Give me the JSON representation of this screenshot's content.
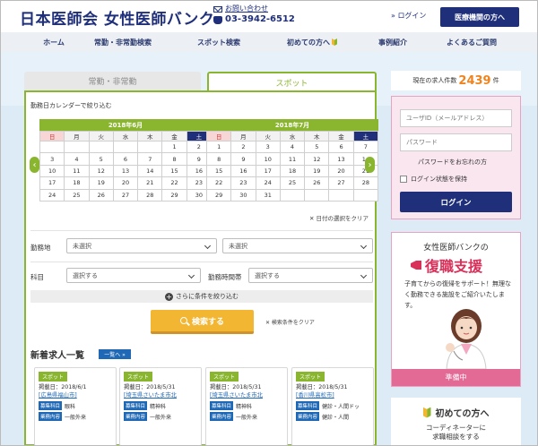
{
  "header": {
    "logo": "日本医師会 女性医師バンク",
    "contact_label": "お問い合わせ",
    "phone": "03-3942-6512",
    "login_link": "» ログイン",
    "institution_button": "医療機関の方へ"
  },
  "nav": {
    "items": [
      "ホーム",
      "常勤・非常勤検索",
      "スポット検索",
      "初めての方へ",
      "事例紹介",
      "よくあるご質問"
    ]
  },
  "search": {
    "tab_fulltime": "常勤・非常勤",
    "tab_spot": "スポット",
    "calendar_title": "勤務日カレンダーで絞り込む",
    "calendars": [
      {
        "title": "2018年6月",
        "rows": [
          [
            "",
            "",
            "",
            "",
            "",
            "1",
            "2"
          ],
          [
            "3",
            "4",
            "5",
            "6",
            "7",
            "8",
            "9"
          ],
          [
            "10",
            "11",
            "12",
            "13",
            "14",
            "15",
            "16"
          ],
          [
            "17",
            "18",
            "19",
            "20",
            "21",
            "22",
            "23"
          ],
          [
            "24",
            "25",
            "26",
            "27",
            "28",
            "29",
            "30"
          ]
        ]
      },
      {
        "title": "2018年7月",
        "rows": [
          [
            "1",
            "2",
            "3",
            "4",
            "5",
            "6",
            "7"
          ],
          [
            "8",
            "9",
            "10",
            "11",
            "12",
            "13",
            "14"
          ],
          [
            "15",
            "16",
            "17",
            "18",
            "19",
            "20",
            "21"
          ],
          [
            "22",
            "23",
            "24",
            "25",
            "26",
            "27",
            "28"
          ],
          [
            "29",
            "30",
            "31",
            "",
            "",
            "",
            ""
          ]
        ]
      }
    ],
    "weekdays": [
      "日",
      "月",
      "火",
      "水",
      "木",
      "金",
      "土"
    ],
    "clear_dates": "✕ 日付の選択をクリア",
    "workplace_label": "勤務地",
    "workplace_value_1": "未選択",
    "workplace_value_2": "未選択",
    "dept_label": "科目",
    "dept_value": "選択する",
    "time_label": "勤務時間帯",
    "time_value": "選択する",
    "more_conditions": "さらに条件を絞り込む",
    "search_button": "検索する",
    "clear_conditions": "✕ 検索条件をクリア"
  },
  "jobs": {
    "title": "新着求人一覧",
    "list_button": "一覧へ »",
    "label_dept": "募集科目",
    "label_content": "業務内容",
    "cards": [
      {
        "tag": "スポット",
        "date": "掲載日：2018/6/1",
        "location": "[広島県福山市]",
        "dept": "眼科",
        "content": "一般外来"
      },
      {
        "tag": "スポット",
        "date": "掲載日：2018/5/31",
        "location": "[埼玉県さいたま市北",
        "dept": "精神科",
        "content": "一般外来"
      },
      {
        "tag": "スポット",
        "date": "掲載日：2018/5/31",
        "location": "[埼玉県さいたま市北",
        "dept": "精神科",
        "content": "一般外来"
      },
      {
        "tag": "スポット",
        "date": "掲載日：2018/5/31",
        "location": "[香川県高松市]",
        "dept": "健診・人間ドッ",
        "content": "健診・人間"
      }
    ]
  },
  "sidebar": {
    "count_label": "現在の求人件数",
    "count_value": "2439",
    "count_unit": "件",
    "user_id_placeholder": "ユーザID（メールアドレス）",
    "password_placeholder": "パスワード",
    "forgot_password": "パスワードをお忘れの方",
    "keep_login": "ログイン状態を保持",
    "login_button": "ログイン",
    "fukushoku_title": "女性医師バンクの",
    "fukushoku_heading": "復職支援",
    "fukushoku_desc": "子育てからの復帰をサポート！無理なく勤務できる施設をご紹介いたします。",
    "junbi": "準備中",
    "first_title": "初めての方へ",
    "first_sub_1": "コーディネーターに",
    "first_sub_2": "求職相談をする"
  }
}
